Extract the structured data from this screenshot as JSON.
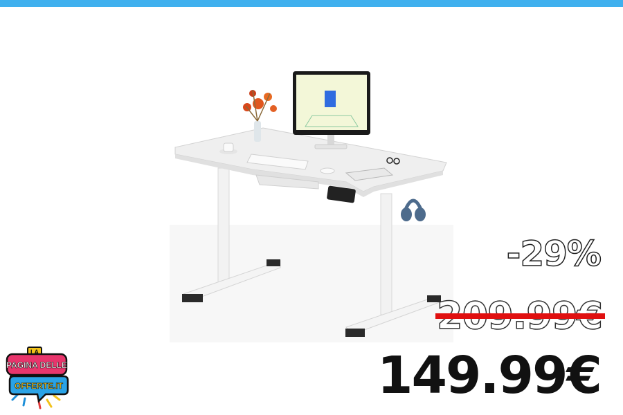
{
  "theme": {
    "accent_color": "#3fb0ee",
    "strike_color": "#e01010"
  },
  "pricing": {
    "discount_label": "-29%",
    "old_price": "209.99€",
    "new_price": "149.99€"
  },
  "logo": {
    "line1": "LA",
    "line2": "PAGINA DELLE",
    "line3": "OFFERTE.IT"
  },
  "product": {
    "icon": "standing-desk-image"
  }
}
